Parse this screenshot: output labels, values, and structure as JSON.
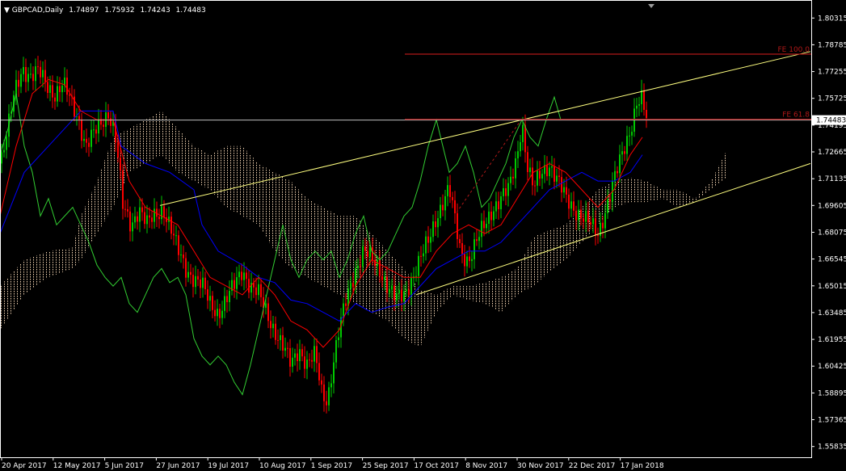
{
  "header": {
    "symbol": "GBPCAD,Daily",
    "open": "1.74897",
    "high": "1.75932",
    "low": "1.74243",
    "close": "1.74483"
  },
  "colors": {
    "background": "#000000",
    "frame": "#ffffff",
    "bull_candle": "#00c800",
    "bear_candle": "#ff0000",
    "tenkan": "#ff0000",
    "kijun": "#0000ff",
    "chikou": "#32cd32",
    "kumo": "#f5d6b4",
    "channel": "#ffff80",
    "fibo": "#b01818",
    "price_line": "#c0c0c0"
  },
  "chart_data": {
    "type": "candlestick",
    "indicators": [
      "Ichimoku Kinko Hyo",
      "Fibonacci Expansion",
      "Trend channel"
    ],
    "y_ticks": [
      "1.80315",
      "1.78785",
      "1.77255",
      "1.75725",
      "1.74195",
      "1.72665",
      "1.71135",
      "1.69605",
      "1.68075",
      "1.66545",
      "1.65015",
      "1.63485",
      "1.61955",
      "1.60425",
      "1.58895",
      "1.57365",
      "1.55835"
    ],
    "ylim": [
      1.5522,
      1.8125
    ],
    "x_ticks": [
      "20 Apr 2017",
      "12 May 2017",
      "5 Jun 2017",
      "27 Jun 2017",
      "19 Jul 2017",
      "10 Aug 2017",
      "1 Sep 2017",
      "25 Sep 2017",
      "17 Oct 2017",
      "8 Nov 2017",
      "30 Nov 2017",
      "22 Dec 2017",
      "17 Jan 2018"
    ],
    "current_price": "1.74483",
    "fibo_levels": [
      {
        "label": "FE 100.0",
        "value": 1.7825
      },
      {
        "label": "FE 61.8",
        "value": 1.7453
      }
    ],
    "price_path": [
      [
        0,
        1.72
      ],
      [
        10,
        1.74
      ],
      [
        18,
        1.76
      ],
      [
        28,
        1.775
      ],
      [
        38,
        1.77
      ],
      [
        48,
        1.772
      ],
      [
        58,
        1.765
      ],
      [
        68,
        1.76
      ],
      [
        78,
        1.765
      ],
      [
        88,
        1.755
      ],
      [
        98,
        1.745
      ],
      [
        106,
        1.73
      ],
      [
        114,
        1.735
      ],
      [
        124,
        1.742
      ],
      [
        134,
        1.75
      ],
      [
        142,
        1.738
      ],
      [
        148,
        1.715
      ],
      [
        152,
        1.695
      ],
      [
        162,
        1.685
      ],
      [
        172,
        1.695
      ],
      [
        182,
        1.685
      ],
      [
        192,
        1.69
      ],
      [
        202,
        1.695
      ],
      [
        210,
        1.685
      ],
      [
        220,
        1.67
      ],
      [
        230,
        1.66
      ],
      [
        240,
        1.655
      ],
      [
        250,
        1.65
      ],
      [
        260,
        1.64
      ],
      [
        270,
        1.635
      ],
      [
        280,
        1.642
      ],
      [
        290,
        1.65
      ],
      [
        300,
        1.66
      ],
      [
        310,
        1.65
      ],
      [
        320,
        1.645
      ],
      [
        330,
        1.635
      ],
      [
        340,
        1.625
      ],
      [
        350,
        1.615
      ],
      [
        360,
        1.605
      ],
      [
        370,
        1.615
      ],
      [
        380,
        1.605
      ],
      [
        390,
        1.61
      ],
      [
        398,
        1.59
      ],
      [
        405,
        1.585
      ],
      [
        412,
        1.605
      ],
      [
        420,
        1.625
      ],
      [
        430,
        1.645
      ],
      [
        440,
        1.66
      ],
      [
        450,
        1.67
      ],
      [
        460,
        1.665
      ],
      [
        470,
        1.66
      ],
      [
        480,
        1.65
      ],
      [
        490,
        1.642
      ],
      [
        500,
        1.645
      ],
      [
        510,
        1.655
      ],
      [
        520,
        1.665
      ],
      [
        530,
        1.675
      ],
      [
        540,
        1.69
      ],
      [
        550,
        1.7
      ],
      [
        556,
        1.705
      ],
      [
        562,
        1.69
      ],
      [
        570,
        1.67
      ],
      [
        580,
        1.665
      ],
      [
        590,
        1.675
      ],
      [
        600,
        1.685
      ],
      [
        610,
        1.695
      ],
      [
        620,
        1.7
      ],
      [
        630,
        1.705
      ],
      [
        640,
        1.725
      ],
      [
        646,
        1.745
      ],
      [
        652,
        1.72
      ],
      [
        660,
        1.705
      ],
      [
        670,
        1.715
      ],
      [
        680,
        1.72
      ],
      [
        690,
        1.71
      ],
      [
        700,
        1.7
      ],
      [
        710,
        1.695
      ],
      [
        720,
        1.69
      ],
      [
        730,
        1.685
      ],
      [
        740,
        1.68
      ],
      [
        750,
        1.695
      ],
      [
        760,
        1.71
      ],
      [
        770,
        1.725
      ],
      [
        780,
        1.74
      ],
      [
        788,
        1.755
      ],
      [
        794,
        1.756
      ],
      [
        800,
        1.745
      ]
    ],
    "tenkan_path": [
      [
        0,
        1.69
      ],
      [
        20,
        1.73
      ],
      [
        40,
        1.76
      ],
      [
        60,
        1.768
      ],
      [
        80,
        1.765
      ],
      [
        100,
        1.75
      ],
      [
        120,
        1.745
      ],
      [
        140,
        1.745
      ],
      [
        160,
        1.71
      ],
      [
        180,
        1.695
      ],
      [
        200,
        1.69
      ],
      [
        220,
        1.685
      ],
      [
        240,
        1.67
      ],
      [
        260,
        1.655
      ],
      [
        280,
        1.65
      ],
      [
        300,
        1.645
      ],
      [
        320,
        1.655
      ],
      [
        340,
        1.645
      ],
      [
        360,
        1.63
      ],
      [
        380,
        1.625
      ],
      [
        400,
        1.615
      ],
      [
        420,
        1.625
      ],
      [
        440,
        1.65
      ],
      [
        460,
        1.665
      ],
      [
        480,
        1.66
      ],
      [
        500,
        1.655
      ],
      [
        520,
        1.655
      ],
      [
        540,
        1.67
      ],
      [
        560,
        1.68
      ],
      [
        580,
        1.685
      ],
      [
        600,
        1.68
      ],
      [
        620,
        1.685
      ],
      [
        640,
        1.7
      ],
      [
        660,
        1.715
      ],
      [
        680,
        1.72
      ],
      [
        700,
        1.715
      ],
      [
        720,
        1.705
      ],
      [
        740,
        1.695
      ],
      [
        760,
        1.705
      ],
      [
        780,
        1.725
      ],
      [
        795,
        1.735
      ]
    ],
    "kijun_path": [
      [
        0,
        1.68
      ],
      [
        30,
        1.715
      ],
      [
        60,
        1.73
      ],
      [
        90,
        1.745
      ],
      [
        100,
        1.75
      ],
      [
        140,
        1.75
      ],
      [
        150,
        1.73
      ],
      [
        180,
        1.72
      ],
      [
        210,
        1.715
      ],
      [
        240,
        1.705
      ],
      [
        250,
        1.685
      ],
      [
        270,
        1.67
      ],
      [
        300,
        1.662
      ],
      [
        320,
        1.655
      ],
      [
        340,
        1.652
      ],
      [
        360,
        1.642
      ],
      [
        380,
        1.64
      ],
      [
        400,
        1.635
      ],
      [
        420,
        1.63
      ],
      [
        440,
        1.64
      ],
      [
        460,
        1.635
      ],
      [
        480,
        1.638
      ],
      [
        500,
        1.64
      ],
      [
        520,
        1.65
      ],
      [
        540,
        1.66
      ],
      [
        560,
        1.665
      ],
      [
        580,
        1.67
      ],
      [
        600,
        1.67
      ],
      [
        620,
        1.675
      ],
      [
        640,
        1.685
      ],
      [
        660,
        1.695
      ],
      [
        680,
        1.705
      ],
      [
        700,
        1.71
      ],
      [
        720,
        1.715
      ],
      [
        740,
        1.71
      ],
      [
        760,
        1.71
      ],
      [
        780,
        1.715
      ],
      [
        795,
        1.725
      ]
    ],
    "chikou_path": [
      [
        0,
        1.725
      ],
      [
        10,
        1.74
      ],
      [
        20,
        1.76
      ],
      [
        30,
        1.73
      ],
      [
        40,
        1.715
      ],
      [
        50,
        1.69
      ],
      [
        60,
        1.7
      ],
      [
        70,
        1.685
      ],
      [
        80,
        1.69
      ],
      [
        90,
        1.695
      ],
      [
        100,
        1.685
      ],
      [
        110,
        1.675
      ],
      [
        120,
        1.662
      ],
      [
        130,
        1.655
      ],
      [
        140,
        1.65
      ],
      [
        150,
        1.655
      ],
      [
        160,
        1.64
      ],
      [
        170,
        1.635
      ],
      [
        180,
        1.645
      ],
      [
        190,
        1.655
      ],
      [
        200,
        1.66
      ],
      [
        210,
        1.652
      ],
      [
        220,
        1.655
      ],
      [
        230,
        1.645
      ],
      [
        240,
        1.62
      ],
      [
        250,
        1.61
      ],
      [
        260,
        1.605
      ],
      [
        270,
        1.61
      ],
      [
        280,
        1.605
      ],
      [
        290,
        1.595
      ],
      [
        300,
        1.588
      ],
      [
        310,
        1.605
      ],
      [
        320,
        1.625
      ],
      [
        330,
        1.645
      ],
      [
        340,
        1.665
      ],
      [
        350,
        1.685
      ],
      [
        360,
        1.665
      ],
      [
        370,
        1.655
      ],
      [
        380,
        1.665
      ],
      [
        390,
        1.67
      ],
      [
        400,
        1.665
      ],
      [
        410,
        1.67
      ],
      [
        420,
        1.655
      ],
      [
        430,
        1.665
      ],
      [
        440,
        1.68
      ],
      [
        450,
        1.69
      ],
      [
        460,
        1.67
      ],
      [
        470,
        1.665
      ],
      [
        480,
        1.67
      ],
      [
        490,
        1.68
      ],
      [
        500,
        1.69
      ],
      [
        510,
        1.695
      ],
      [
        520,
        1.71
      ],
      [
        530,
        1.73
      ],
      [
        540,
        1.745
      ],
      [
        548,
        1.73
      ],
      [
        556,
        1.715
      ],
      [
        566,
        1.72
      ],
      [
        576,
        1.73
      ],
      [
        586,
        1.715
      ],
      [
        596,
        1.695
      ],
      [
        606,
        1.7
      ],
      [
        616,
        1.71
      ],
      [
        626,
        1.72
      ],
      [
        636,
        1.735
      ],
      [
        646,
        1.745
      ],
      [
        656,
        1.735
      ],
      [
        666,
        1.73
      ],
      [
        676,
        1.745
      ],
      [
        686,
        1.758
      ],
      [
        694,
        1.745
      ]
    ],
    "kumo_upper": [
      [
        0,
        1.65
      ],
      [
        30,
        1.665
      ],
      [
        60,
        1.67
      ],
      [
        90,
        1.672
      ],
      [
        100,
        1.69
      ],
      [
        120,
        1.71
      ],
      [
        140,
        1.735
      ],
      [
        160,
        1.74
      ],
      [
        180,
        1.745
      ],
      [
        200,
        1.75
      ],
      [
        220,
        1.74
      ],
      [
        240,
        1.73
      ],
      [
        260,
        1.725
      ],
      [
        280,
        1.73
      ],
      [
        300,
        1.73
      ],
      [
        320,
        1.72
      ],
      [
        340,
        1.715
      ],
      [
        360,
        1.71
      ],
      [
        380,
        1.7
      ],
      [
        400,
        1.695
      ],
      [
        420,
        1.69
      ],
      [
        440,
        1.69
      ],
      [
        460,
        1.68
      ],
      [
        480,
        1.67
      ],
      [
        500,
        1.66
      ],
      [
        520,
        1.648
      ],
      [
        540,
        1.645
      ],
      [
        560,
        1.65
      ],
      [
        580,
        1.65
      ],
      [
        600,
        1.652
      ],
      [
        620,
        1.655
      ],
      [
        640,
        1.66
      ],
      [
        660,
        1.678
      ],
      [
        680,
        1.682
      ],
      [
        700,
        1.685
      ],
      [
        720,
        1.695
      ],
      [
        740,
        1.705
      ],
      [
        760,
        1.71
      ],
      [
        780,
        1.712
      ],
      [
        800,
        1.71
      ],
      [
        820,
        1.705
      ],
      [
        840,
        1.705
      ],
      [
        860,
        1.7
      ],
      [
        880,
        1.71
      ],
      [
        900,
        1.728
      ]
    ],
    "kumo_lower": [
      [
        0,
        1.625
      ],
      [
        30,
        1.645
      ],
      [
        60,
        1.655
      ],
      [
        90,
        1.66
      ],
      [
        100,
        1.665
      ],
      [
        120,
        1.68
      ],
      [
        140,
        1.695
      ],
      [
        160,
        1.715
      ],
      [
        180,
        1.72
      ],
      [
        200,
        1.725
      ],
      [
        220,
        1.715
      ],
      [
        240,
        1.71
      ],
      [
        260,
        1.705
      ],
      [
        280,
        1.695
      ],
      [
        300,
        1.69
      ],
      [
        320,
        1.685
      ],
      [
        340,
        1.67
      ],
      [
        360,
        1.66
      ],
      [
        380,
        1.655
      ],
      [
        400,
        1.65
      ],
      [
        420,
        1.645
      ],
      [
        440,
        1.64
      ],
      [
        460,
        1.635
      ],
      [
        480,
        1.63
      ],
      [
        500,
        1.62
      ],
      [
        520,
        1.615
      ],
      [
        540,
        1.635
      ],
      [
        560,
        1.645
      ],
      [
        580,
        1.642
      ],
      [
        600,
        1.64
      ],
      [
        620,
        1.635
      ],
      [
        640,
        1.645
      ],
      [
        660,
        1.65
      ],
      [
        680,
        1.658
      ],
      [
        700,
        1.665
      ],
      [
        720,
        1.675
      ],
      [
        740,
        1.685
      ],
      [
        760,
        1.695
      ],
      [
        780,
        1.698
      ],
      [
        800,
        1.698
      ],
      [
        820,
        1.7
      ],
      [
        840,
        1.695
      ],
      [
        860,
        1.698
      ],
      [
        880,
        1.705
      ],
      [
        900,
        1.712
      ]
    ],
    "channel_upper": [
      [
        198,
        1.696
      ],
      [
        1003,
        1.784
      ]
    ],
    "channel_lower": [
      [
        515,
        1.645
      ],
      [
        1003,
        1.72
      ]
    ],
    "fibo_trend": [
      [
        565,
        1.692
      ],
      [
        645,
        1.745
      ]
    ]
  }
}
